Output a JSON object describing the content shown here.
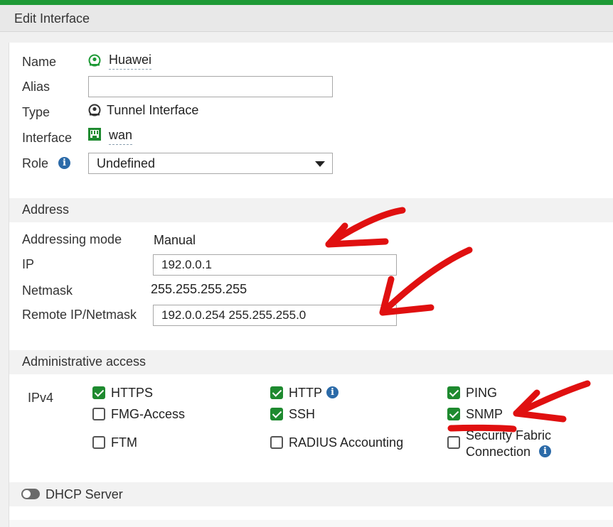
{
  "window": {
    "title": "Edit Interface"
  },
  "general": {
    "name_label": "Name",
    "name_value": "Huawei",
    "alias_label": "Alias",
    "alias_value": "",
    "alias_placeholder": "",
    "type_label": "Type",
    "type_value": "Tunnel Interface",
    "interface_label": "Interface",
    "interface_value": "wan",
    "role_label": "Role",
    "role_value": "Undefined"
  },
  "address": {
    "header": "Address",
    "mode_label": "Addressing mode",
    "mode_value": "Manual",
    "ip_label": "IP",
    "ip_value": "192.0.0.1",
    "netmask_label": "Netmask",
    "netmask_value": "255.255.255.255",
    "remote_label": "Remote IP/Netmask",
    "remote_value": "192.0.0.254 255.255.255.0"
  },
  "admin": {
    "header": "Administrative access",
    "ipv4_label": "IPv4",
    "options": [
      {
        "label": "HTTPS",
        "checked": true
      },
      {
        "label": "HTTP",
        "checked": true
      },
      {
        "label": "PING",
        "checked": true
      },
      {
        "label": "FMG-Access",
        "checked": false
      },
      {
        "label": "SSH",
        "checked": true
      },
      {
        "label": "SNMP",
        "checked": true
      },
      {
        "label": "FTM",
        "checked": false
      },
      {
        "label": "RADIUS Accounting",
        "checked": false
      },
      {
        "label": "Security Fabric",
        "label2": "Connection",
        "checked": false
      }
    ]
  },
  "dhcp": {
    "label": "DHCP Server",
    "enabled": false
  },
  "colors": {
    "accent": "#1e9a36",
    "checkbox_on": "#1e8a2f",
    "info": "#2b6aa8",
    "annotation": "#e01010"
  },
  "icons": {
    "name": "tunnel-interface-icon",
    "type": "tunnel-interface-icon",
    "interface": "ethernet-port-icon",
    "info": "info-icon"
  }
}
